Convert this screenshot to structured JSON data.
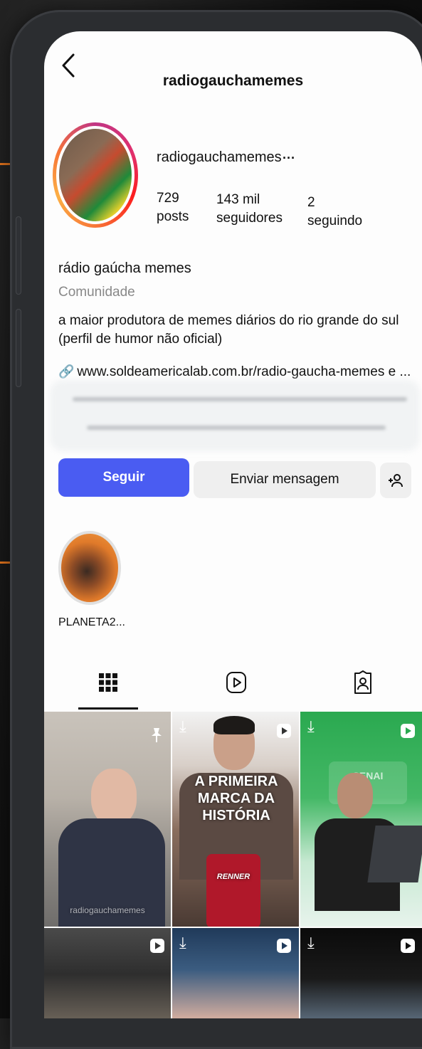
{
  "header": {
    "back_label": "‹",
    "title": "radiogauchamemes"
  },
  "profile": {
    "username": "radiogauchamemes",
    "more_label": "···",
    "stats": [
      {
        "value": "729",
        "label": "posts"
      },
      {
        "value": "143 mil",
        "label": "seguidores"
      },
      {
        "value": "2",
        "label": "seguindo"
      }
    ],
    "display_name": "rádio gaúcha memes",
    "category": "Comunidade",
    "bio": "a maior produtora de memes diários do rio grande do sul (perfil de humor não oficial)",
    "link": "www.soldeamericalab.com.br/radio-gaucha-memes e ..."
  },
  "actions": {
    "follow_label": "Seguir",
    "message_label": "Enviar mensagem",
    "add_person_icon": "add-person-icon"
  },
  "highlights": [
    {
      "label": "PLANETA2..."
    }
  ],
  "tabs": [
    {
      "icon": "grid-icon",
      "active": true
    },
    {
      "icon": "reels-icon",
      "active": false
    },
    {
      "icon": "tagged-icon",
      "active": false
    }
  ],
  "posts": [
    {
      "caption": "",
      "icon": "pin-icon",
      "watermark": "radiogauchamemes"
    },
    {
      "caption": "A PRIMEIRA MARCA DA HISTÓRIA",
      "icon": "reel-icon",
      "product_label": "RENNER"
    },
    {
      "caption": "",
      "icon": "reel-icon",
      "sign_text": "SENAI"
    },
    {
      "caption": "",
      "icon": "reel-icon"
    },
    {
      "caption": "",
      "icon": "reel-icon"
    },
    {
      "caption": "",
      "icon": "reel-icon"
    }
  ],
  "colors": {
    "follow_button": "#4a5cf2",
    "accent_lines": "#e8771e",
    "story_ring": [
      "#c13584",
      "#fd1d1d",
      "#fcaf45"
    ]
  }
}
